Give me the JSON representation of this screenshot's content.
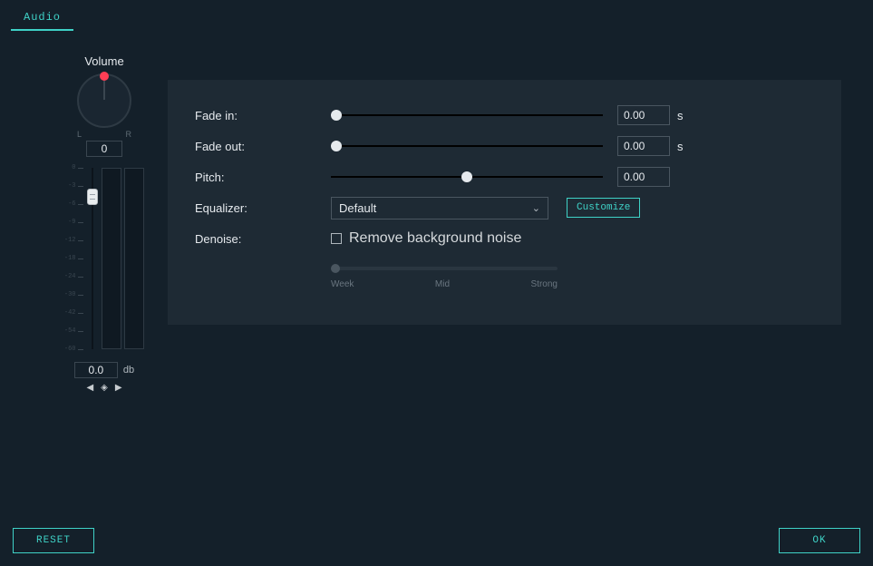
{
  "tab": {
    "label": "Audio"
  },
  "volume": {
    "title": "Volume",
    "pan_l": "L",
    "pan_r": "R",
    "pan_value": "0",
    "db_value": "0.0",
    "db_unit": "db",
    "scale": [
      "0",
      "-3",
      "-6",
      "-9",
      "-12",
      "-18",
      "-24",
      "-30",
      "-42",
      "-54",
      "-60"
    ]
  },
  "controls": {
    "fade_in": {
      "label": "Fade in:",
      "value": "0.00",
      "unit": "s",
      "pos": 2
    },
    "fade_out": {
      "label": "Fade out:",
      "value": "0.00",
      "unit": "s",
      "pos": 2
    },
    "pitch": {
      "label": "Pitch:",
      "value": "0.00",
      "pos": 50
    },
    "equalizer": {
      "label": "Equalizer:",
      "selected": "Default",
      "customize": "Customize"
    },
    "denoise": {
      "label": "Denoise:",
      "checkbox_label": "Remove background noise",
      "levels": {
        "weak": "Week",
        "mid": "Mid",
        "strong": "Strong"
      }
    }
  },
  "footer": {
    "reset": "RESET",
    "ok": "OK"
  }
}
